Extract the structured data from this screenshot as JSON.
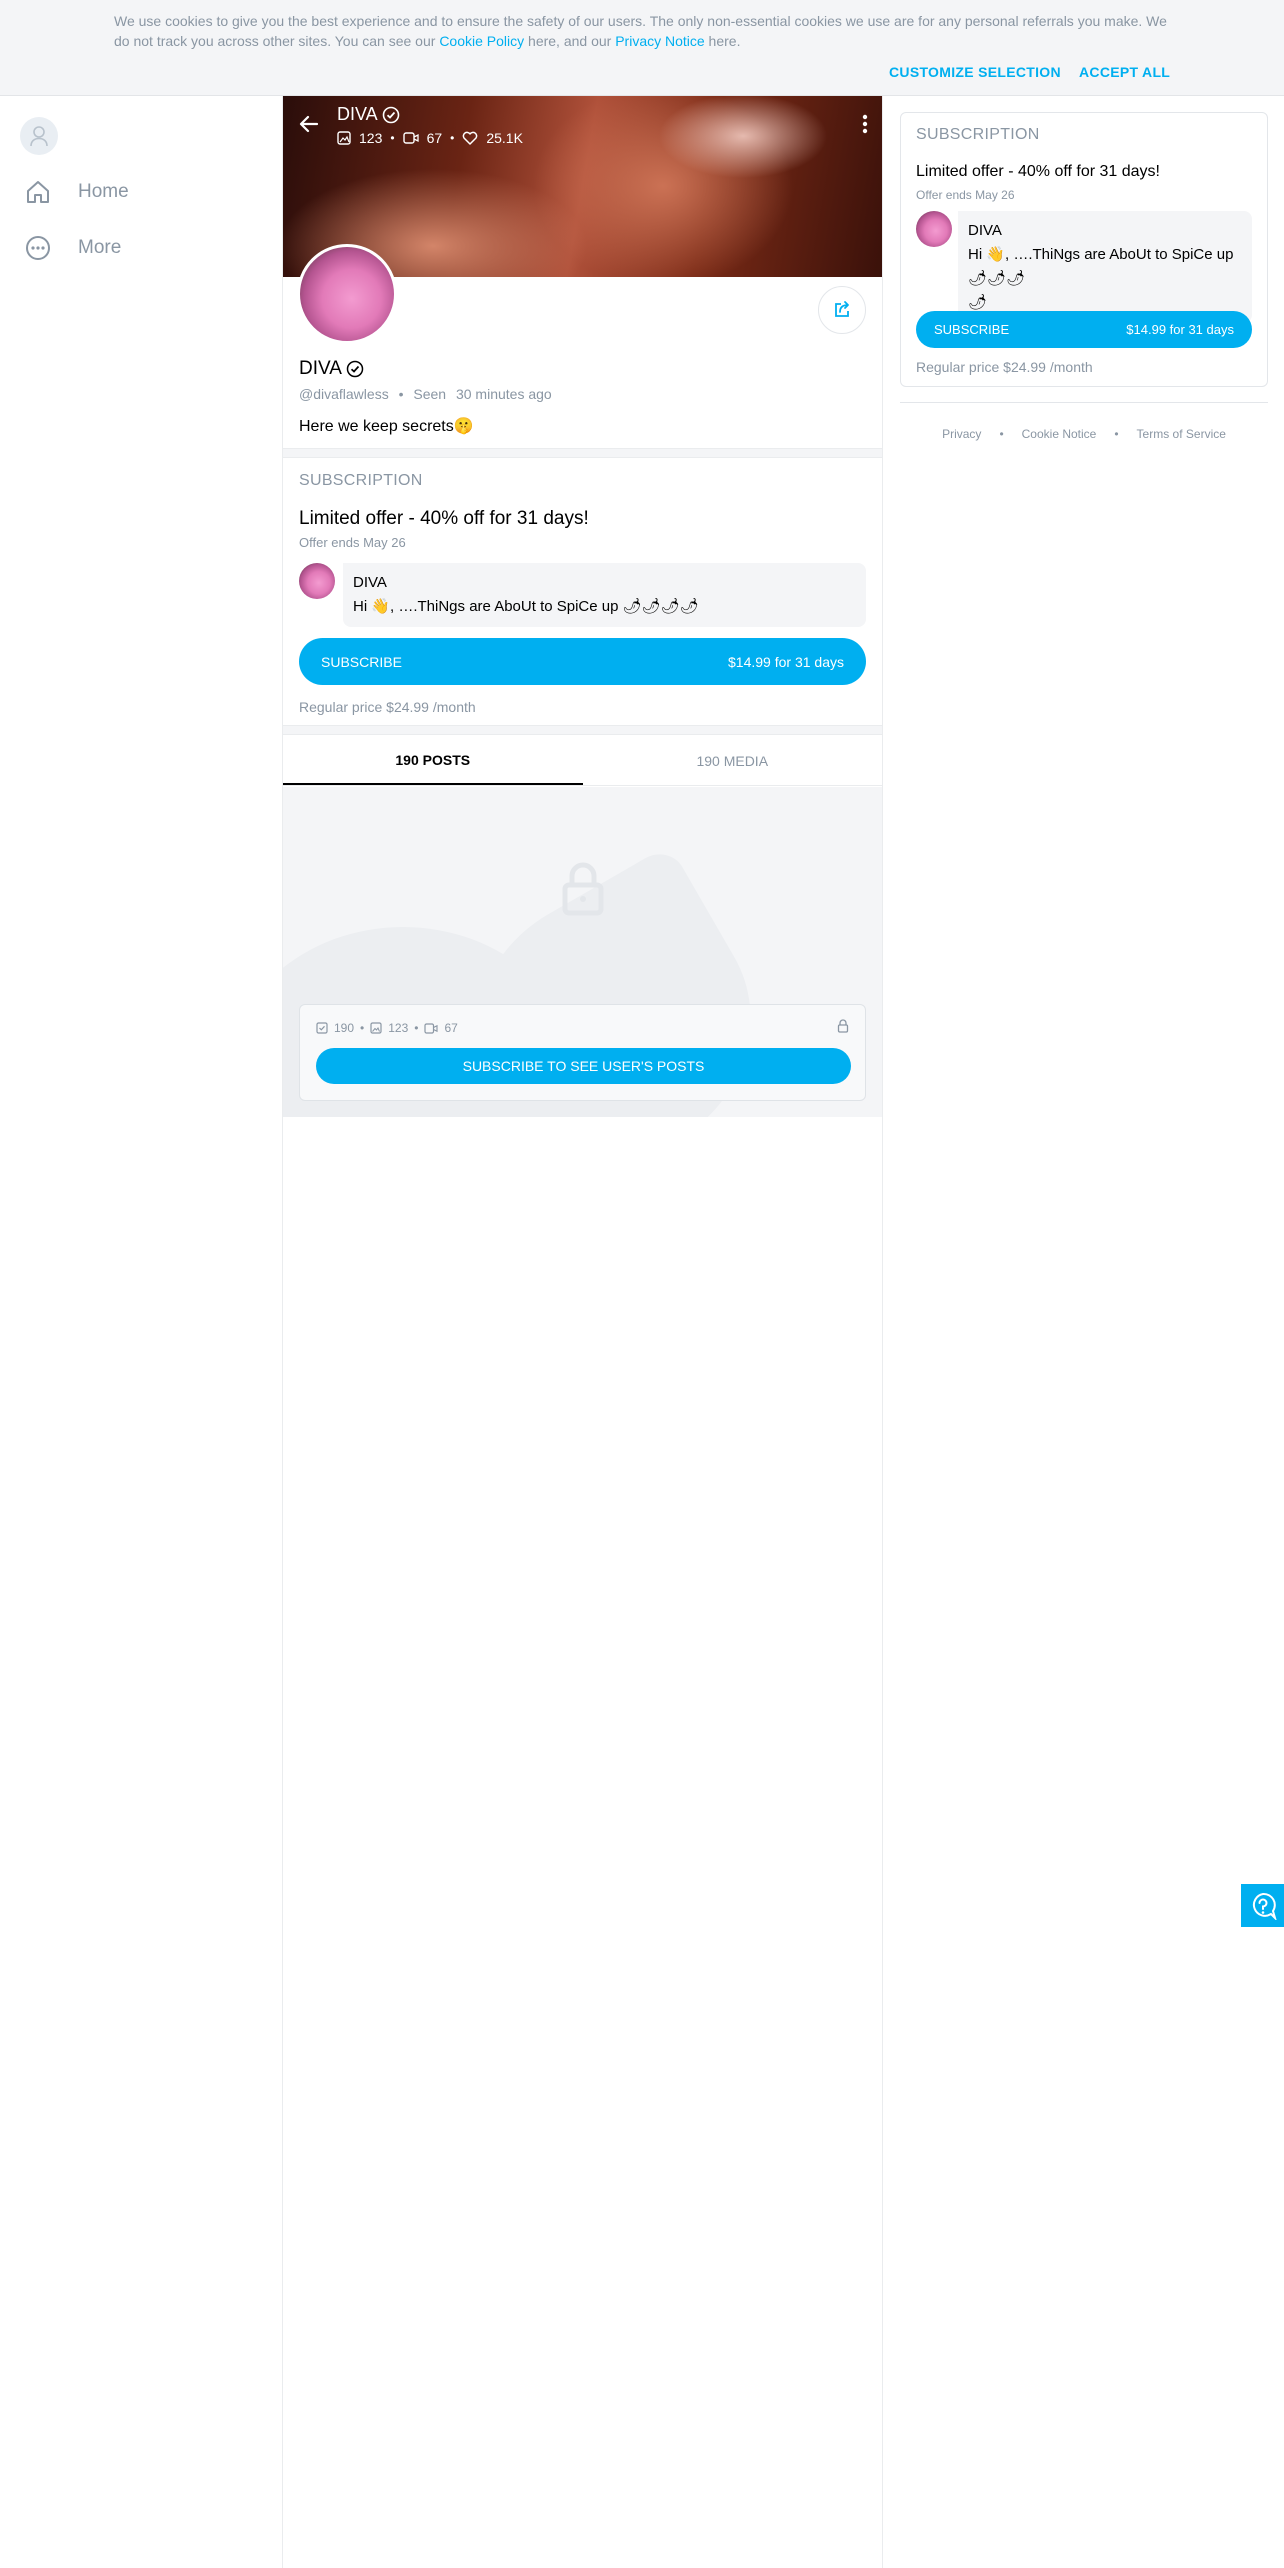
{
  "cookie": {
    "text_1": "We use cookies to give you the best experience and to ensure the safety of our users. The only non-essential cookies we use are for any personal referrals you make. We do not track you across other sites. You can see our ",
    "cookie_policy": "Cookie Policy",
    "text_2": " here, and our ",
    "privacy_notice": "Privacy Notice",
    "text_3": " here.",
    "customize": "CUSTOMIZE SELECTION",
    "accept": "ACCEPT ALL"
  },
  "sidebar": {
    "items": [
      {
        "label": "Home",
        "icon": "home-icon"
      },
      {
        "label": "More",
        "icon": "more-icon"
      }
    ]
  },
  "profile": {
    "name": "DIVA",
    "photos": "123",
    "videos": "67",
    "likes": "25.1K",
    "handle": "@divaflawless",
    "seen_label": "Seen",
    "seen_time": "30 minutes ago",
    "bio": "Here we keep secrets🤫"
  },
  "subscription": {
    "heading": "SUBSCRIPTION",
    "offer_title": "Limited offer - 40% off for 31 days!",
    "offer_ends": "Offer ends May 26",
    "msg_name": "DIVA",
    "msg_text": "Hi 👋, ….ThiNgs are AboUt to SpiCe up 🌶🌶🌶🌶",
    "msg_text_side_1": "Hi 👋, ….ThiNgs are AboUt to SpiCe up 🌶🌶🌶",
    "msg_text_side_2": "🌶",
    "subscribe_label": "SUBSCRIBE",
    "price_label": "$14.99 for 31 days",
    "regular_price": "Regular price $24.99 /month"
  },
  "tabs": [
    {
      "label": "190 POSTS",
      "active": true
    },
    {
      "label": "190 MEDIA",
      "active": false
    }
  ],
  "locked": {
    "posts": "190",
    "photos": "123",
    "videos": "67",
    "button": "SUBSCRIBE TO SEE USER'S POSTS"
  },
  "footer": {
    "privacy": "Privacy",
    "cookie_notice": "Cookie Notice",
    "terms": "Terms of Service"
  },
  "colors": {
    "accent": "#00aff0",
    "muted": "#8a96a3",
    "border": "#eaecee"
  }
}
